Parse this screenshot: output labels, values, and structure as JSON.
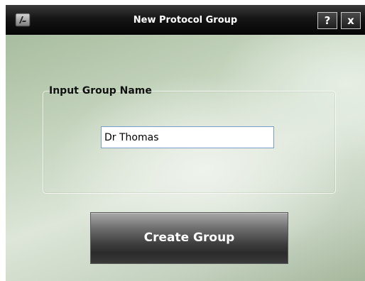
{
  "window": {
    "title": "New Protocol Group",
    "app_icon": "app-logo-icon",
    "help_label": "?",
    "close_label": "x"
  },
  "group": {
    "label": "Input Group Name",
    "input_value": "Dr Thomas"
  },
  "actions": {
    "create_label": "Create Group"
  },
  "colors": {
    "titlebar": "#111111",
    "background_accent": "#c3d3bc",
    "input_border": "#7a9cc8",
    "button_dark": "#2b2b2b"
  }
}
